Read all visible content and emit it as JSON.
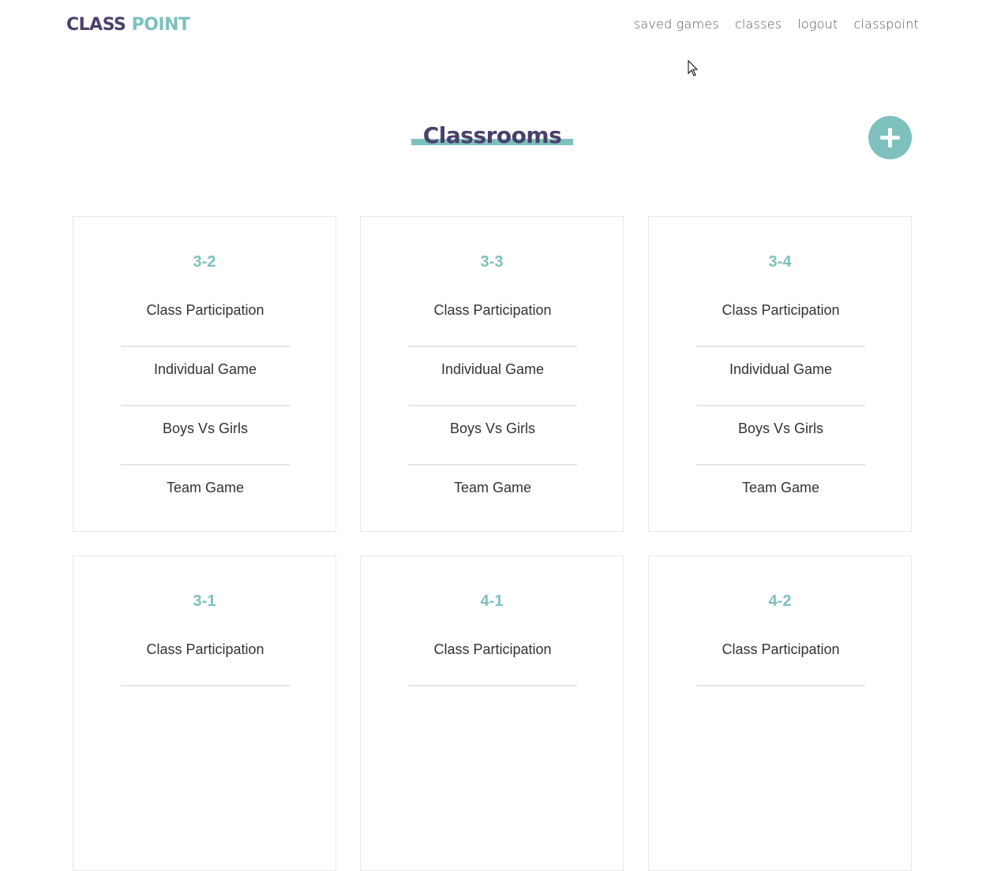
{
  "header": {
    "logo_part1": "CLASS",
    "logo_part2": "POINT",
    "nav": [
      "saved games",
      "classes",
      "logout",
      "classpoint"
    ]
  },
  "page": {
    "title": "Classrooms",
    "add_icon": "plus-icon"
  },
  "colors": {
    "brand_dark": "#4b3f6b",
    "accent": "#7dc0be",
    "text": "#333333"
  },
  "classrooms": [
    {
      "name": "3-2",
      "options": [
        "Class Participation",
        "Individual Game",
        "Boys Vs Girls",
        "Team Game"
      ]
    },
    {
      "name": "3-3",
      "options": [
        "Class Participation",
        "Individual Game",
        "Boys Vs Girls",
        "Team Game"
      ]
    },
    {
      "name": "3-4",
      "options": [
        "Class Participation",
        "Individual Game",
        "Boys Vs Girls",
        "Team Game"
      ]
    },
    {
      "name": "3-1",
      "options": [
        "Class Participation"
      ]
    },
    {
      "name": "4-1",
      "options": [
        "Class Participation"
      ]
    },
    {
      "name": "4-2",
      "options": [
        "Class Participation"
      ]
    }
  ]
}
